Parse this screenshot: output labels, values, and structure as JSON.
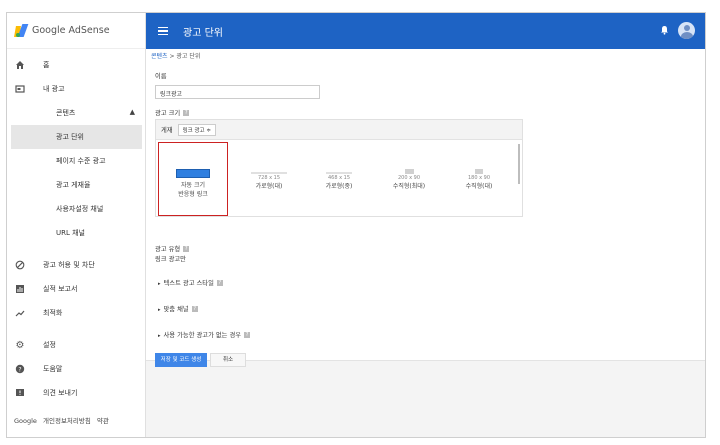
{
  "sidebar": {
    "brand": "Google AdSense",
    "items": [
      {
        "label": "홈",
        "icon": "home-icon"
      },
      {
        "label": "내 광고",
        "icon": "ads-icon"
      },
      {
        "label": "콘텐츠",
        "icon": ""
      },
      {
        "label": "광고 단위",
        "icon": ""
      },
      {
        "label": "페이지 수준 광고",
        "icon": ""
      },
      {
        "label": "광고 게재율",
        "icon": ""
      },
      {
        "label": "사용자설정 채널",
        "icon": ""
      },
      {
        "label": "URL 채널",
        "icon": ""
      },
      {
        "label": "광고 허용 및 차단",
        "icon": "block-icon"
      },
      {
        "label": "실적 보고서",
        "icon": "report-icon"
      },
      {
        "label": "최적화",
        "icon": "trend-icon"
      },
      {
        "label": "설정",
        "icon": "gear-icon"
      },
      {
        "label": "도움말",
        "icon": "help-icon"
      },
      {
        "label": "의견 보내기",
        "icon": "feedback-icon"
      }
    ],
    "footer": {
      "google": "Google",
      "privacy": "개인정보처리방침",
      "terms": "약관"
    }
  },
  "header": {
    "title": "광고 단위"
  },
  "breadcrumb": {
    "parent": "콘텐츠",
    "sep": " > ",
    "current": "광고 단위"
  },
  "form": {
    "name_label": "이름",
    "name_value": "링크광고",
    "size_label": "광고 크기",
    "size_head_label": "게재",
    "size_select_value": "링크 광고 ≑",
    "sizes": [
      {
        "dim": "",
        "top": "자동 크기",
        "cap": "반응형 링크"
      },
      {
        "dim": "728 x 15",
        "cap": "가로형(대)"
      },
      {
        "dim": "468 x 15",
        "cap": "가로형(중)"
      },
      {
        "dim": "200 x 90",
        "cap": "수직형(최대)"
      },
      {
        "dim": "180 x 90",
        "cap": "수직형(대)"
      }
    ],
    "type_label": "광고 유형",
    "type_value": "링크 광고만",
    "sec_text_style": "텍스트 광고 스타일",
    "sec_custom_channel": "맞춤 채널",
    "sec_no_ad": "사용 가능한 광고가 없는 경우",
    "save_label": "저장 및 코드 생성",
    "cancel_label": "취소"
  },
  "colors": {
    "accent": "#1e63c4",
    "selected_outline": "#cc2222",
    "save_button": "#3f86e8"
  }
}
